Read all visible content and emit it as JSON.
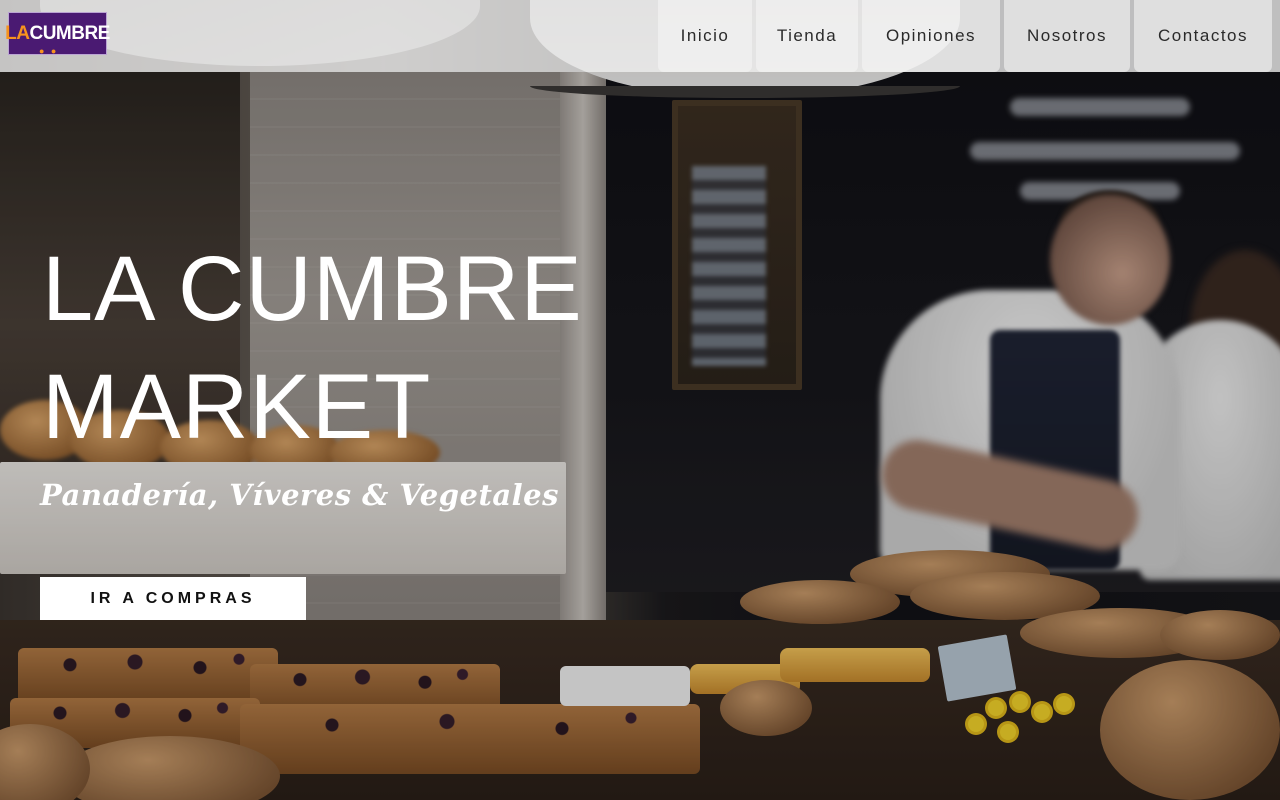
{
  "brand": {
    "logo_la": "LA",
    "logo_cumbre": "CUMBRE",
    "colors": {
      "purple": "#4a1a72",
      "orange": "#f7931e"
    }
  },
  "nav": {
    "items": [
      {
        "label": "Inicio"
      },
      {
        "label": "Tienda"
      },
      {
        "label": "Opiniones"
      },
      {
        "label": "Nosotros"
      },
      {
        "label": "Contactos"
      }
    ]
  },
  "hero": {
    "title_line1": "LA CUMBRE",
    "title_line2": "MARKET",
    "subtitle": "Panadería, Víveres & Vegetales",
    "cta_label": "IR A COMPRAS",
    "background": "bakery-counter-photo"
  }
}
